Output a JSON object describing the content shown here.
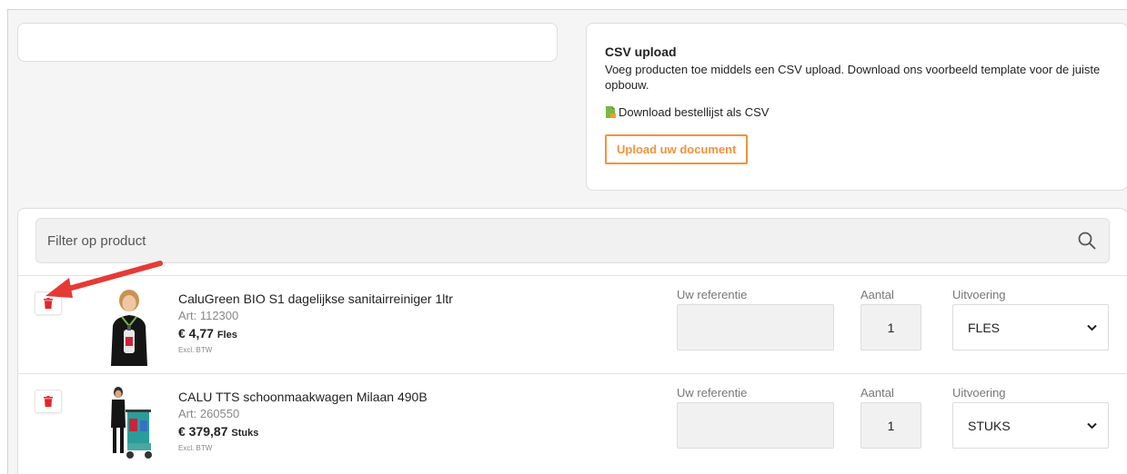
{
  "csv": {
    "title": "CSV upload",
    "description": "Voeg producten toe middels een CSV upload. Download ons voorbeeld template voor de juiste opbouw.",
    "download_label": "Download bestellijst als CSV",
    "upload_label": "Upload uw document"
  },
  "filter": {
    "placeholder": "Filter op product"
  },
  "products": [
    {
      "name": "CaluGreen BIO S1 dagelijkse sanitairreiniger 1ltr",
      "art": "Art: 112300",
      "price": "€ 4,77",
      "unit": "Fles",
      "btw": "Excl. BTW",
      "reference_label": "Uw referentie",
      "reference_value": "",
      "quantity_label": "Aantal",
      "quantity": "1",
      "variant_label": "Uitvoering",
      "variant": "FLES"
    },
    {
      "name": "CALU TTS schoonmaakwagen Milaan 490B",
      "art": "Art: 260550",
      "price": "€ 379,87",
      "unit": "Stuks",
      "btw": "Excl. BTW",
      "reference_label": "Uw referentie",
      "reference_value": "",
      "quantity_label": "Aantal",
      "quantity": "1",
      "variant_label": "Uitvoering",
      "variant": "STUKS"
    }
  ],
  "colors": {
    "accent": "#f2933b",
    "trash": "#e3262b",
    "arrow": "#e63a35",
    "csv_icon": "#7ab648"
  },
  "icons": {
    "trash": "trash-icon",
    "search": "search-icon",
    "csv": "csv-file-icon",
    "chevron": "chevron-down-icon"
  }
}
